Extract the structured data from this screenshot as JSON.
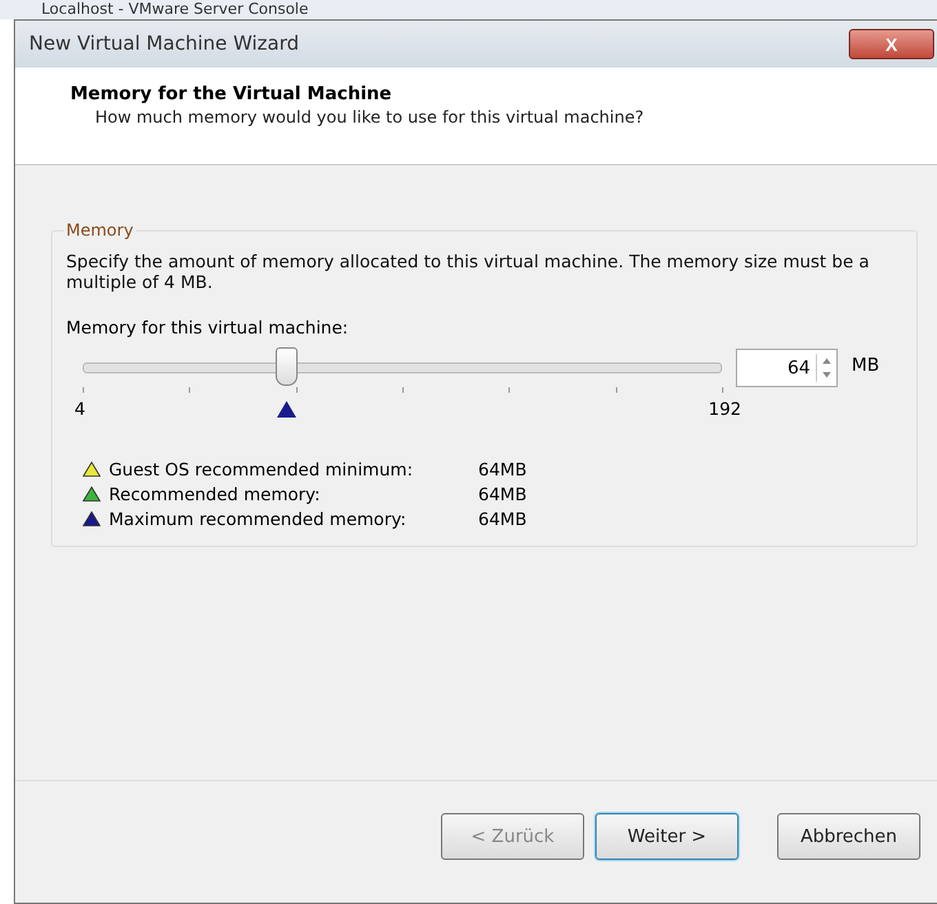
{
  "background_window": {
    "title": "Localhost - VMware Server Console"
  },
  "window": {
    "title": "New Virtual Machine Wizard",
    "close": "X"
  },
  "header": {
    "title": "Memory for the Virtual Machine",
    "subtitle": "How much memory would you like to use for this virtual machine?"
  },
  "memory_group": {
    "legend": "Memory",
    "description": "Specify the amount of memory allocated to this virtual machine. The memory size must be a multiple of 4 MB.",
    "slider_label": "Memory for this virtual machine:",
    "slider": {
      "level": 0.319,
      "min_label": "4",
      "max_label": "192",
      "marker": {
        "level": 0.319,
        "color": "#1a1a8c"
      }
    },
    "spinner": {
      "value": "64",
      "unit": "MB"
    },
    "legend_items": [
      {
        "label": "Guest OS recommended minimum:",
        "value": "64MB",
        "color": "#e8e83a"
      },
      {
        "label": "Recommended memory:",
        "value": "64MB",
        "color": "#3cb43c"
      },
      {
        "label": "Maximum recommended memory:",
        "value": "64MB",
        "color": "#1a1a8c"
      }
    ]
  },
  "buttons": [
    {
      "label": "< Zurück",
      "disabled": true,
      "default": false
    },
    {
      "label": "Weiter >",
      "disabled": false,
      "default": true
    },
    {
      "label": "Abbrechen",
      "disabled": false,
      "default": false
    }
  ]
}
